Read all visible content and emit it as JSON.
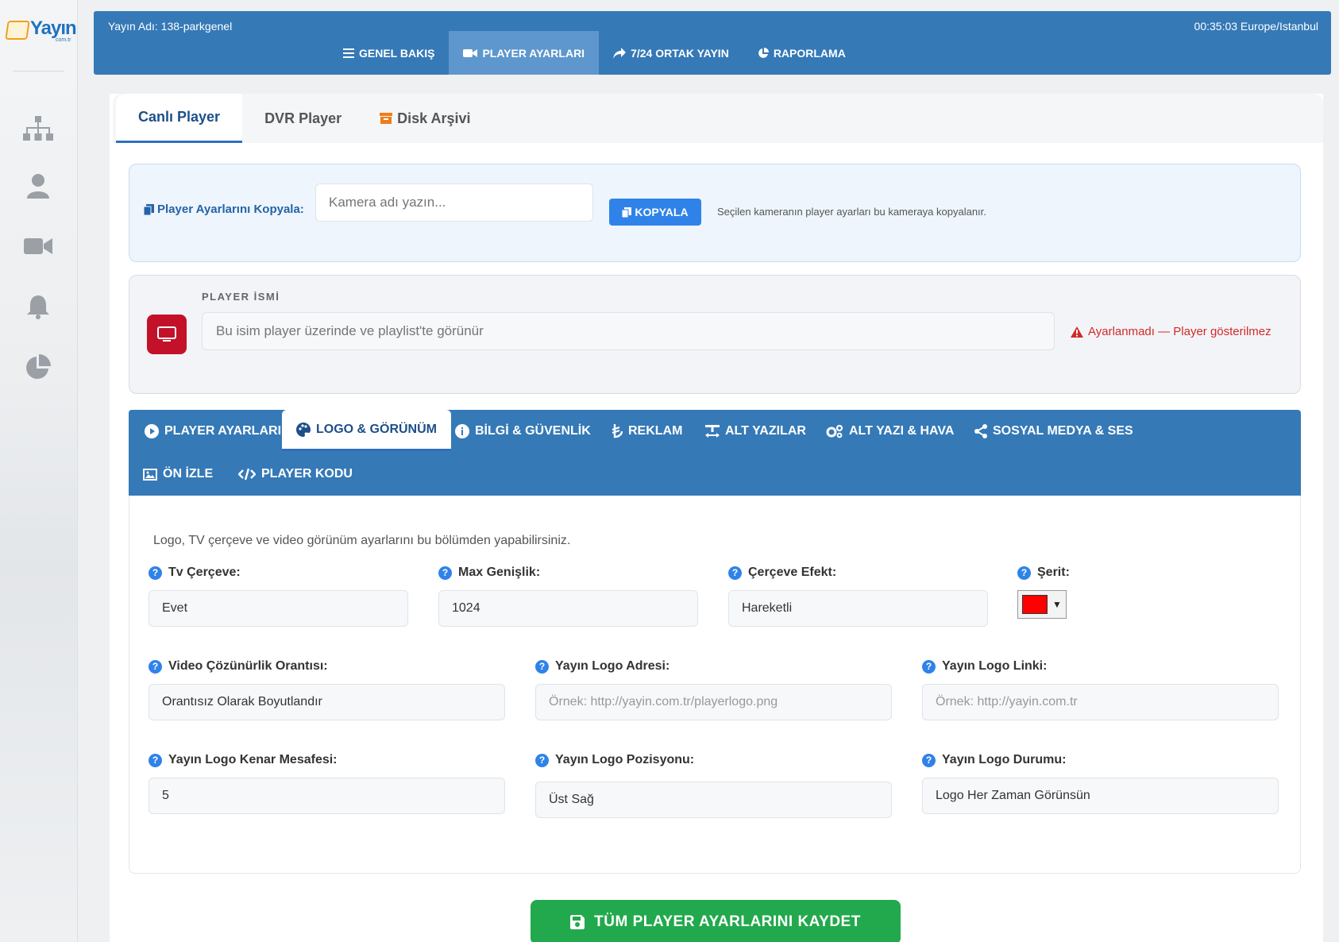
{
  "brand": {
    "name": "Yayın",
    "sub": "com.tr"
  },
  "header": {
    "station": "Yayın Adı: 138-parkgenel",
    "clock": "00:35:03 Europe/Istanbul",
    "nav": [
      {
        "label": "GENEL BAKIŞ",
        "icon": "menu-icon"
      },
      {
        "label": "PLAYER AYARLARI",
        "icon": "video-camera-icon",
        "active": true
      },
      {
        "label": "7/24 ORTAK YAYIN",
        "icon": "share-arrow-icon"
      },
      {
        "label": "RAPORLAMA",
        "icon": "pie-chart-icon"
      }
    ]
  },
  "tabs": [
    {
      "label": "Canlı Player",
      "active": true
    },
    {
      "label": "DVR Player"
    },
    {
      "label": "Disk Arşivi",
      "icon": "archive-icon"
    }
  ],
  "copy": {
    "label": "Player Ayarlarını Kopyala:",
    "placeholder": "Kamera adı yazın...",
    "button": "KOPYALA",
    "hint": "Seçilen kameranın player ayarları bu kameraya kopyalanır."
  },
  "player_name": {
    "caption": "PLAYER İSMİ",
    "placeholder": "Bu isim player üzerinde ve playlist'te görünür",
    "warning": "Ayarlanmadı — Player gösterilmez"
  },
  "subtabs": [
    {
      "label": "PLAYER AYARLARI"
    },
    {
      "label": "LOGO & GÖRÜNÜM",
      "active": true
    },
    {
      "label": "BİLGİ & GÜVENLİK"
    },
    {
      "label": "REKLAM"
    },
    {
      "label": "ALT YAZILAR"
    },
    {
      "label": "ALT YAZI & HAVA"
    },
    {
      "label": "SOSYAL MEDYA & SES"
    },
    {
      "label": "ÖN İZLE"
    },
    {
      "label": "PLAYER KODU"
    }
  ],
  "panel": {
    "desc": "Logo, TV çerçeve ve video görünüm ayarlarını bu bölümden yapabilirsiniz.",
    "fields": {
      "tv_frame": {
        "label": "Tv Çerçeve:",
        "value": "Evet"
      },
      "max_width": {
        "label": "Max Genişlik:",
        "value": "1024"
      },
      "frame_effect": {
        "label": "Çerçeve Efekt:",
        "value": "Hareketli"
      },
      "stripe": {
        "label": "Şerit:",
        "color": "#ff0000"
      },
      "aspect": {
        "label": "Video Çözünürlik Orantısı:",
        "value": "Orantısız Olarak Boyutlandır"
      },
      "logo_url": {
        "label": "Yayın Logo Adresi:",
        "placeholder": "Örnek: http://yayin.com.tr/playerlogo.png"
      },
      "logo_link": {
        "label": "Yayın Logo Linki:",
        "placeholder": "Örnek: http://yayin.com.tr"
      },
      "logo_margin": {
        "label": "Yayın Logo Kenar Mesafesi:",
        "value": "5"
      },
      "logo_position": {
        "label": "Yayın Logo Pozisyonu:",
        "value": "Üst Sağ"
      },
      "logo_status": {
        "label": "Yayın Logo Durumu:",
        "value": "Logo Her Zaman Görünsün"
      }
    }
  },
  "save_button": "TÜM PLAYER AYARLARINI KAYDET"
}
